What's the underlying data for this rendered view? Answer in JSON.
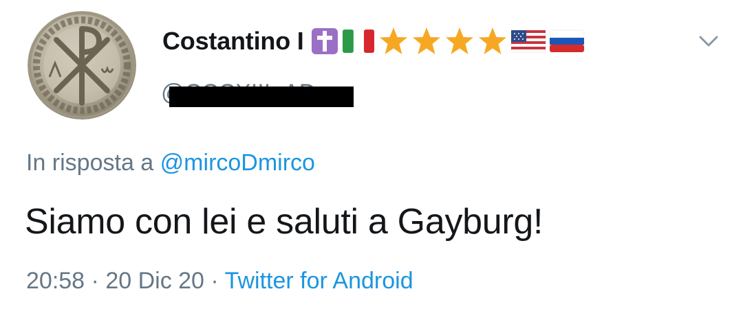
{
  "tweet": {
    "display_name": "Costantino I",
    "badges": [
      "latin-cross-icon",
      "italy-flag-icon",
      "star-icon",
      "star-icon",
      "star-icon",
      "star-icon",
      "usa-flag-icon",
      "russia-flag-icon"
    ],
    "handle": "@CCCXIII_AD",
    "reply_prefix": "In risposta a",
    "reply_handle": "@mircoDmirco",
    "text": "Siamo con lei e saluti a Gayburg!",
    "time": "20:58",
    "sep1": "·",
    "date": "20 Dic 20",
    "sep2": "·",
    "source": "Twitter for Android"
  },
  "colors": {
    "name": "#14171a",
    "secondary": "#657786",
    "link": "#1b95e0",
    "cross_badge": "#9b6fc6",
    "star": "#f7a823"
  }
}
